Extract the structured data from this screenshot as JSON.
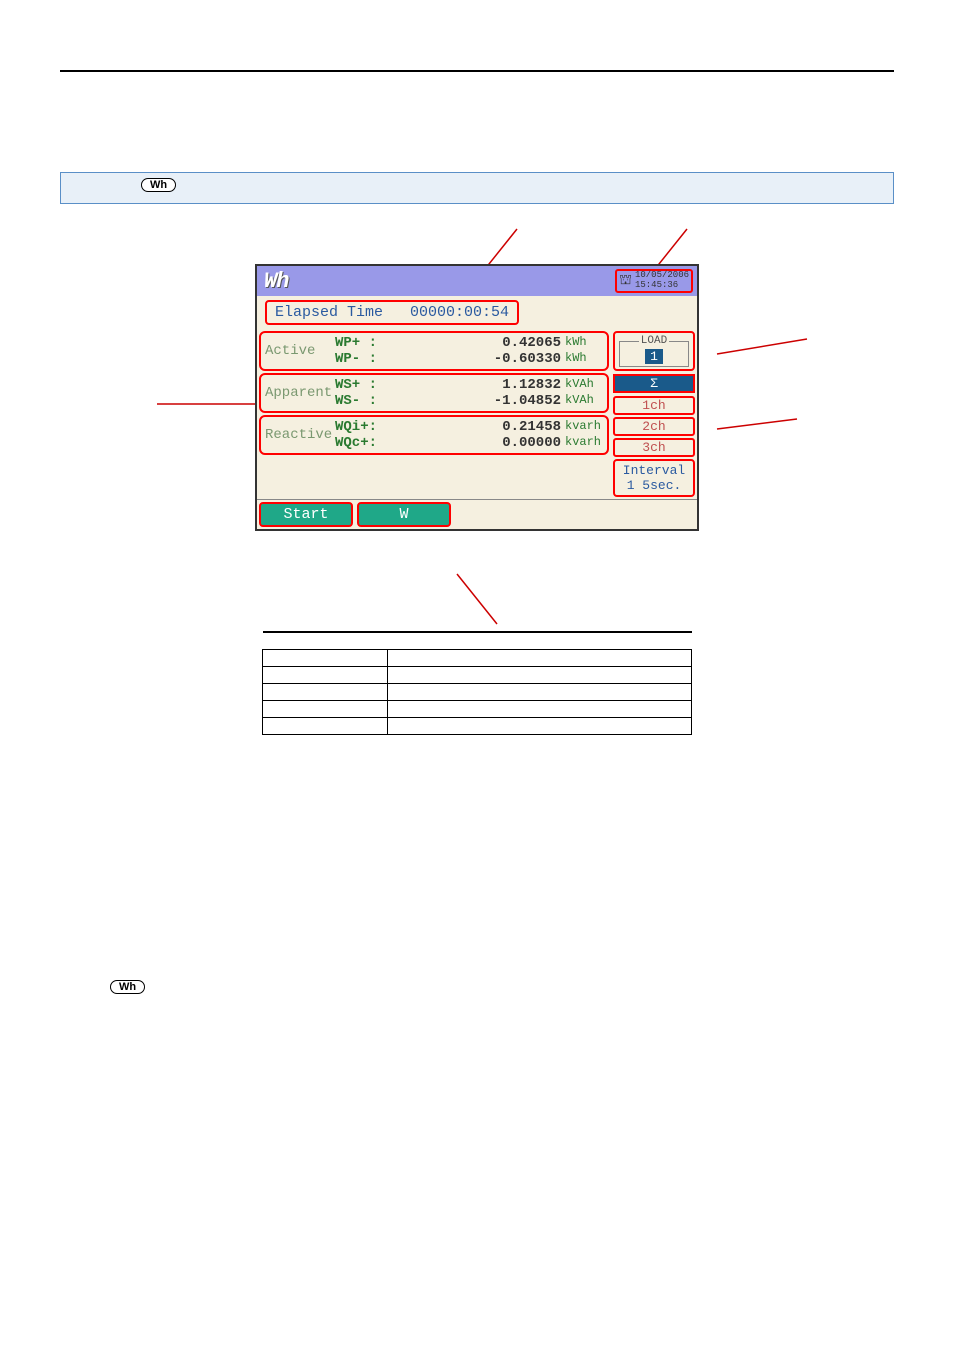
{
  "header": {
    "wh_label": "Wh",
    "logo": "Wh",
    "date": "10/05/2006",
    "time": "15:45:36"
  },
  "elapsed": {
    "label": "Elapsed Time",
    "value": "00000:00:54"
  },
  "measurements": {
    "active": {
      "label": "Active",
      "rows": [
        {
          "sym": "WP+ :",
          "val": "0.42065",
          "unit": "kWh"
        },
        {
          "sym": "WP- :",
          "val": "-0.60330",
          "unit": "kWh"
        }
      ]
    },
    "apparent": {
      "label": "Apparent",
      "rows": [
        {
          "sym": "WS+ :",
          "val": "1.12832",
          "unit": "kVAh"
        },
        {
          "sym": "WS- :",
          "val": "-1.04852",
          "unit": "kVAh"
        }
      ]
    },
    "reactive": {
      "label": "Reactive",
      "rows": [
        {
          "sym": "WQi+:",
          "val": "0.21458",
          "unit": "kvarh"
        },
        {
          "sym": "WQc+:",
          "val": "0.00000",
          "unit": "kvarh"
        }
      ]
    }
  },
  "sidebar": {
    "load_label": "LOAD",
    "load_value": "1",
    "sigma": "Σ",
    "channels": [
      "1ch",
      "2ch",
      "3ch"
    ],
    "interval_label": "Interval",
    "interval_value": "1 5sec."
  },
  "footer": {
    "start": "Start",
    "w": "W"
  },
  "table_rows": [
    {
      "c1": "",
      "c2": ""
    },
    {
      "c1": "",
      "c2": ""
    },
    {
      "c1": "",
      "c2": ""
    },
    {
      "c1": "",
      "c2": ""
    },
    {
      "c1": "",
      "c2": ""
    },
    {
      "c1": "",
      "c2": ""
    }
  ]
}
